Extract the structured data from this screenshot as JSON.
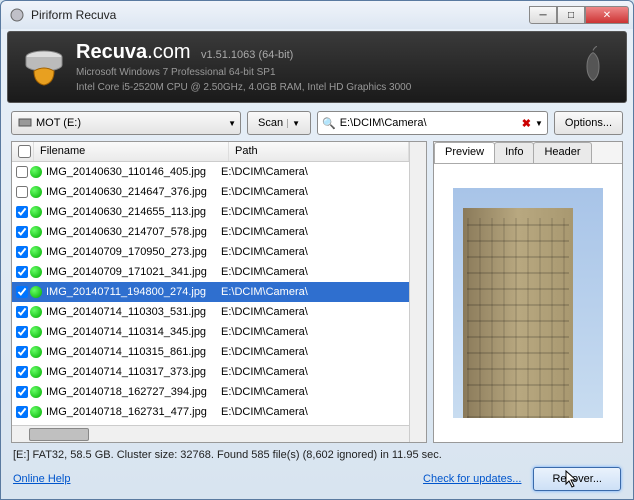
{
  "window": {
    "title": "Piriform Recuva"
  },
  "header": {
    "brand_bold": "Recuva",
    "brand_suffix": ".com",
    "version": "v1.51.1063 (64-bit)",
    "sys1": "Microsoft Windows 7 Professional 64-bit SP1",
    "sys2": "Intel Core i5-2520M CPU @ 2.50GHz, 4.0GB RAM, Intel HD Graphics 3000"
  },
  "toolbar": {
    "drive": "MOT (E:)",
    "scan": "Scan",
    "path": "E:\\DCIM\\Camera\\",
    "options": "Options..."
  },
  "columns": {
    "filename": "Filename",
    "path": "Path"
  },
  "files": [
    {
      "checked": false,
      "status": "good",
      "name": "IMG_20140630_110146_405.jpg",
      "path": "E:\\DCIM\\Camera\\"
    },
    {
      "checked": false,
      "status": "good",
      "name": "IMG_20140630_214647_376.jpg",
      "path": "E:\\DCIM\\Camera\\"
    },
    {
      "checked": true,
      "status": "good",
      "name": "IMG_20140630_214655_113.jpg",
      "path": "E:\\DCIM\\Camera\\"
    },
    {
      "checked": true,
      "status": "good",
      "name": "IMG_20140630_214707_578.jpg",
      "path": "E:\\DCIM\\Camera\\"
    },
    {
      "checked": true,
      "status": "good",
      "name": "IMG_20140709_170950_273.jpg",
      "path": "E:\\DCIM\\Camera\\"
    },
    {
      "checked": true,
      "status": "good",
      "name": "IMG_20140709_171021_341.jpg",
      "path": "E:\\DCIM\\Camera\\"
    },
    {
      "checked": true,
      "status": "good",
      "name": "IMG_20140711_194800_274.jpg",
      "path": "E:\\DCIM\\Camera\\",
      "selected": true
    },
    {
      "checked": true,
      "status": "good",
      "name": "IMG_20140714_110303_531.jpg",
      "path": "E:\\DCIM\\Camera\\"
    },
    {
      "checked": true,
      "status": "good",
      "name": "IMG_20140714_110314_345.jpg",
      "path": "E:\\DCIM\\Camera\\"
    },
    {
      "checked": true,
      "status": "good",
      "name": "IMG_20140714_110315_861.jpg",
      "path": "E:\\DCIM\\Camera\\"
    },
    {
      "checked": true,
      "status": "good",
      "name": "IMG_20140714_110317_373.jpg",
      "path": "E:\\DCIM\\Camera\\"
    },
    {
      "checked": true,
      "status": "good",
      "name": "IMG_20140718_162727_394.jpg",
      "path": "E:\\DCIM\\Camera\\"
    },
    {
      "checked": true,
      "status": "good",
      "name": "IMG_20140718_162731_477.jpg",
      "path": "E:\\DCIM\\Camera\\"
    }
  ],
  "tabs": {
    "preview": "Preview",
    "info": "Info",
    "header": "Header",
    "active": "preview"
  },
  "status": "[E:] FAT32, 58.5 GB. Cluster size: 32768. Found 585 file(s) (8,602 ignored) in 11.95 sec.",
  "footer": {
    "help": "Online Help",
    "updates": "Check for updates...",
    "recover": "Recover..."
  }
}
